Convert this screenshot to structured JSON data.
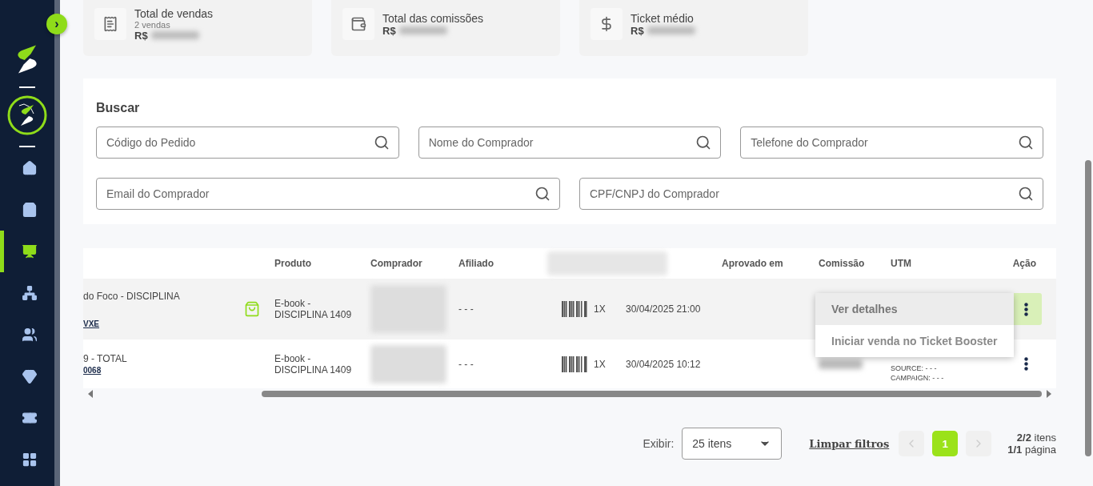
{
  "sidebar": {
    "expand_button": "›",
    "items": [
      {
        "selected": false
      },
      {
        "selected": false
      },
      {
        "selected": true
      },
      {
        "selected": false
      },
      {
        "selected": false
      },
      {
        "selected": false
      },
      {
        "selected": false
      },
      {
        "selected": false
      }
    ]
  },
  "summary_cards": [
    {
      "title": "Total de vendas",
      "subtitle": "2 vendas",
      "value_prefix": "R$"
    },
    {
      "title": "Total das comissões",
      "value_prefix": "R$"
    },
    {
      "title": "Ticket médio",
      "value_prefix": "R$"
    }
  ],
  "search": {
    "title": "Buscar",
    "fields": [
      {
        "placeholder": "Código do Pedido"
      },
      {
        "placeholder": "Nome do Comprador"
      },
      {
        "placeholder": "Telefone do Comprador"
      },
      {
        "placeholder": "Email do Comprador"
      },
      {
        "placeholder": "CPF/CNPJ do Comprador"
      }
    ]
  },
  "table": {
    "columns": [
      "",
      "Produto",
      "Comprador",
      "Afiliado",
      "",
      "",
      "Aprovado em",
      "Comissão",
      "UTM",
      "Ação"
    ],
    "rows": [
      {
        "selected": true,
        "offer": "do Foco - DISCIPLINA",
        "code": "VXE",
        "bag": true,
        "product": "E-book - DISCIPLINA 1409",
        "affiliate": "- - -",
        "quantity": "1X",
        "date": "30/04/2025 21:00",
        "utm": []
      },
      {
        "selected": false,
        "offer": "9 - TOTAL",
        "code": "0068",
        "bag": false,
        "product": "E-book - DISCIPLINA 1409",
        "affiliate": "- - -",
        "quantity": "1X",
        "date": "30/04/2025 10:12",
        "utm": [
          "SOURCE: - - -",
          "CAMPAIGN: - - -"
        ]
      }
    ]
  },
  "action_menu": {
    "items": [
      {
        "label": "Ver detalhes",
        "selected": true
      },
      {
        "label": "Iniciar venda no Ticket Booster",
        "selected": false
      }
    ]
  },
  "pagination": {
    "show_label": "Exibir:",
    "page_size": "25 itens",
    "clear_filters": "Limpar filtros",
    "pages": [
      {
        "label": "1",
        "selected": true
      }
    ],
    "prev_disabled": true,
    "next_disabled": true,
    "items_count": "**2/2** itens",
    "pages_count": "**1/1** página"
  }
}
